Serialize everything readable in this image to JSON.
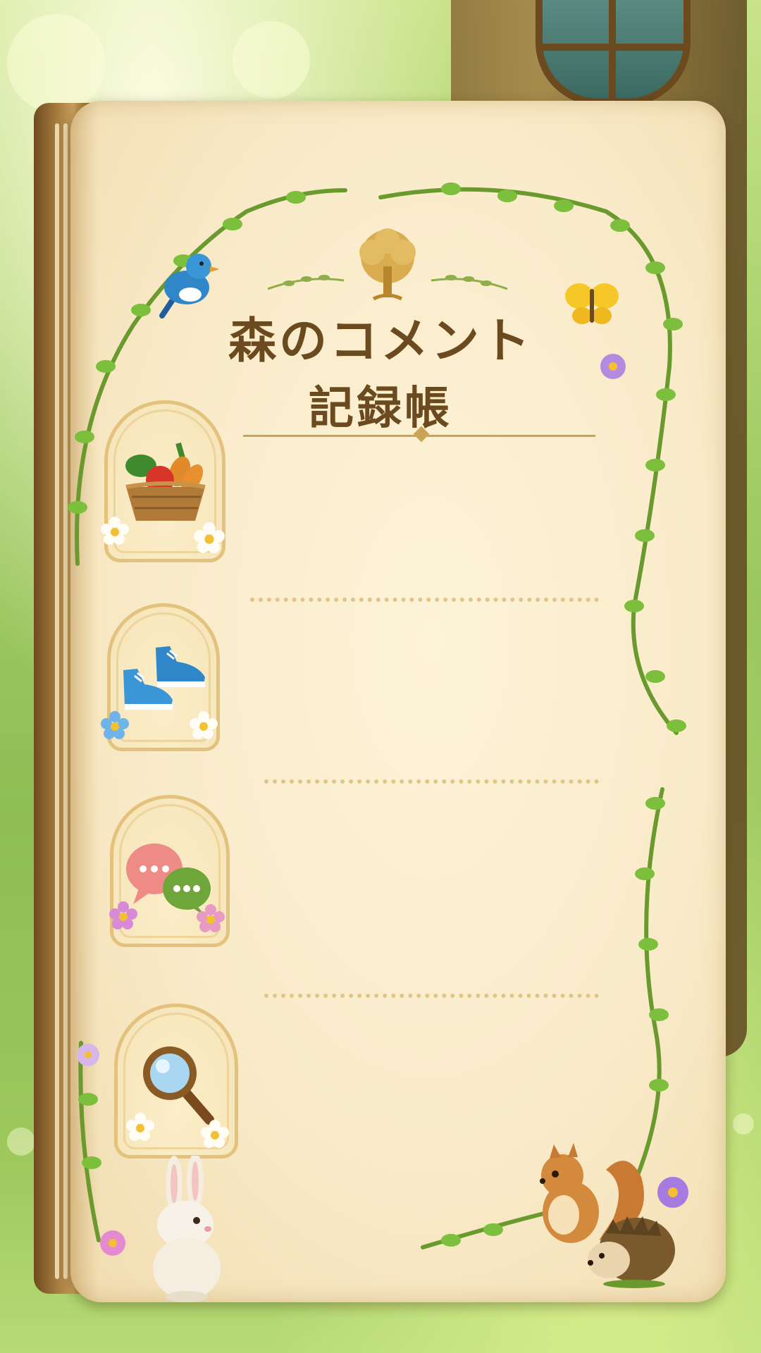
{
  "title": {
    "line1": "森のコメント",
    "line2": "記録帳"
  },
  "sections": [
    {
      "icon": "vegetable-basket-icon"
    },
    {
      "icon": "sneakers-icon"
    },
    {
      "icon": "speech-bubbles-icon"
    },
    {
      "icon": "magnifying-glass-icon"
    }
  ],
  "decorations": [
    "tree-emblem-icon",
    "bluebird-icon",
    "butterfly-icon",
    "rabbit-icon",
    "squirrel-icon",
    "hedgehog-icon",
    "vine-border"
  ],
  "colors": {
    "title": "#6b4a20",
    "gold": "#c9a456",
    "paper": "#f9ebc9",
    "leaf": "#6fae3a"
  }
}
